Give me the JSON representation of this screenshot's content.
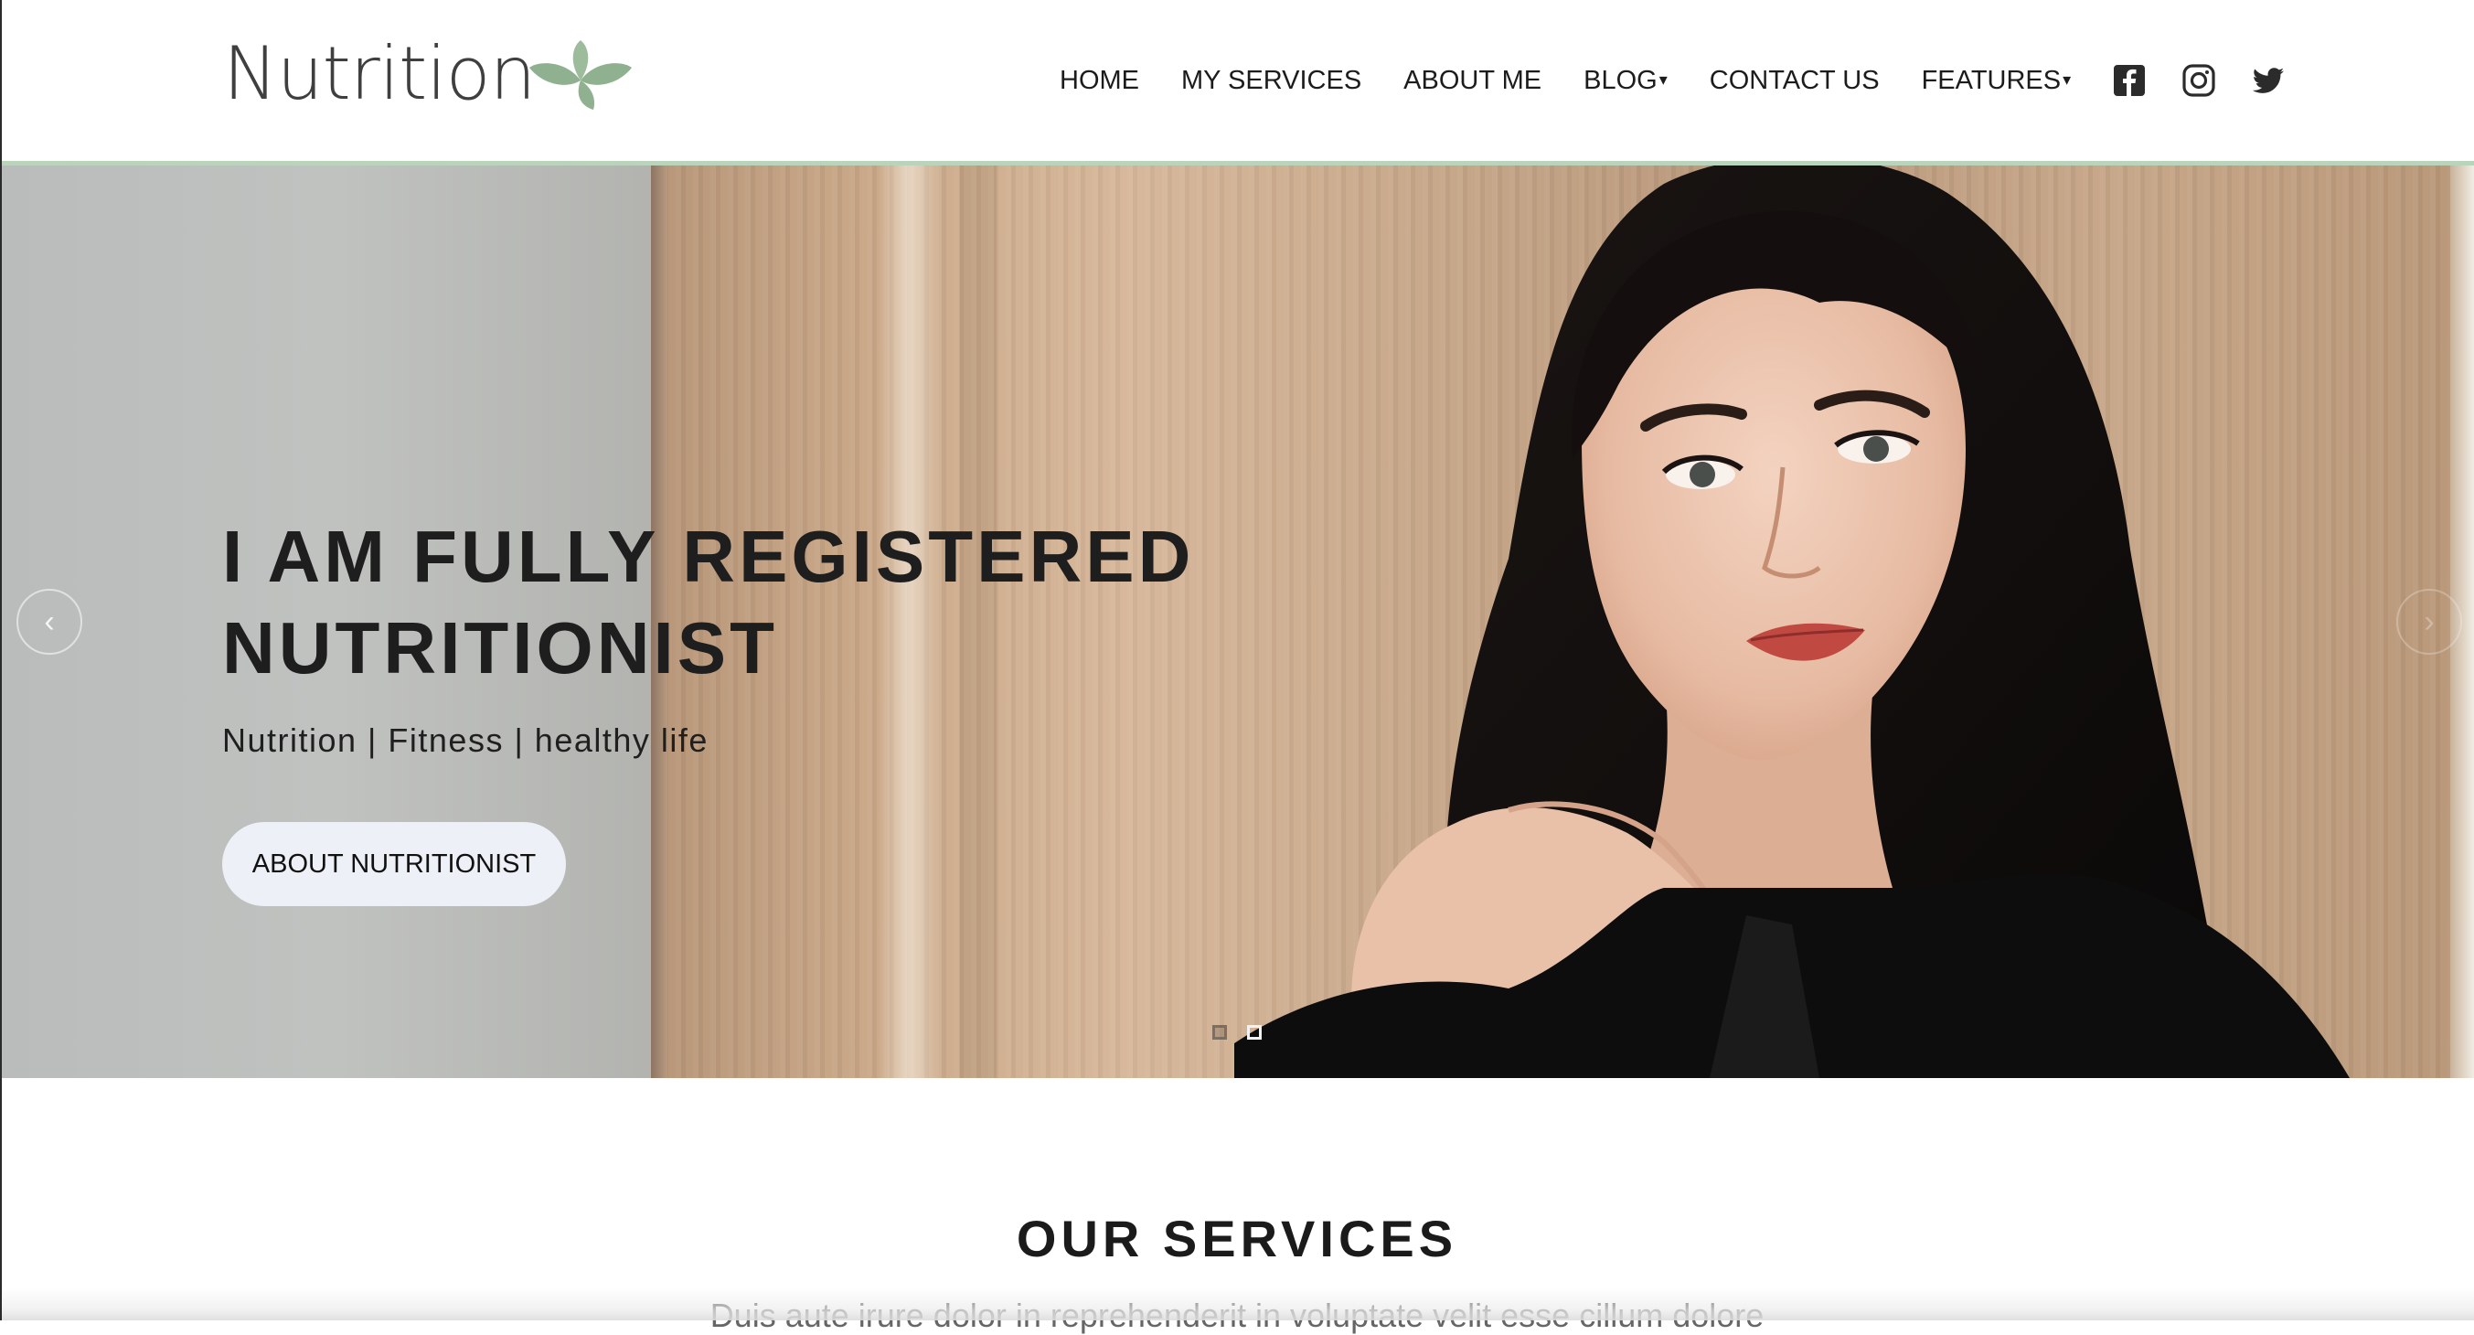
{
  "brand": {
    "name": "Nutrition",
    "leaf_color": "#8fb18f"
  },
  "nav": {
    "items": [
      {
        "label": "HOME",
        "dropdown": false
      },
      {
        "label": "MY SERVICES",
        "dropdown": false
      },
      {
        "label": "ABOUT ME",
        "dropdown": false
      },
      {
        "label": "BLOG",
        "dropdown": true
      },
      {
        "label": "CONTACT US",
        "dropdown": false
      },
      {
        "label": "FEATURES",
        "dropdown": true
      }
    ],
    "dropdown_caret": "▾",
    "social_icons": [
      "facebook-icon",
      "instagram-icon",
      "twitter-icon"
    ]
  },
  "hero": {
    "title_line1": "I AM FULLY REGISTERED",
    "title_line2": "NUTRITIONIST",
    "subtitle": "Nutrition | Fitness | healthy life",
    "button_label": "ABOUT NUTRITIONIST",
    "prev_icon": "‹",
    "next_icon": "›",
    "slides": 2,
    "active_slide": 1
  },
  "services": {
    "title": "OUR SERVICES",
    "intro": "Duis aute irure dolor in reprehenderit in voluptate velit esse cillum dolore"
  },
  "colors": {
    "accent_rule": "#b9d4bb",
    "button_bg": "#edf0f7",
    "text": "#1b1b1b"
  }
}
